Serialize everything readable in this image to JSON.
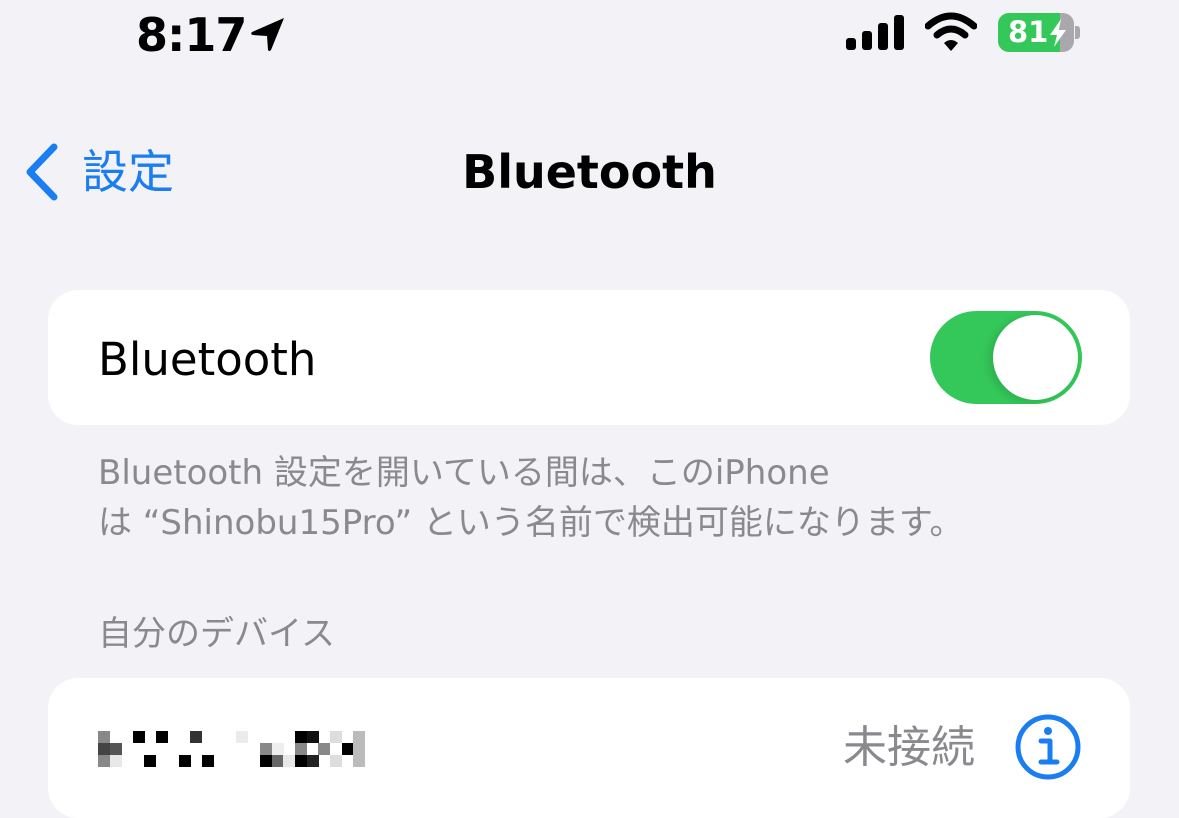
{
  "status_bar": {
    "time": "8:17",
    "location_icon": "location-arrow-icon",
    "signal_icon": "cellular-signal-icon",
    "wifi_icon": "wifi-icon",
    "battery_level": 81,
    "battery_text": "81",
    "battery_charging": true,
    "battery_color": "#34c759"
  },
  "nav": {
    "back_label": "設定",
    "title": "Bluetooth",
    "accent": "#1a7ef2"
  },
  "bluetooth_toggle": {
    "label": "Bluetooth",
    "on": true,
    "color": "#34c759"
  },
  "footer_text": {
    "line1": "Bluetooth 設定を開いている間は、このiPhone",
    "line2": "は “Shinobu15Pro” という名前で検出可能になります。"
  },
  "my_devices": {
    "header": "自分のデバイス",
    "items": [
      {
        "name": "[pixelated]",
        "status": "未接続",
        "info_icon": "info-circle-icon"
      }
    ]
  }
}
